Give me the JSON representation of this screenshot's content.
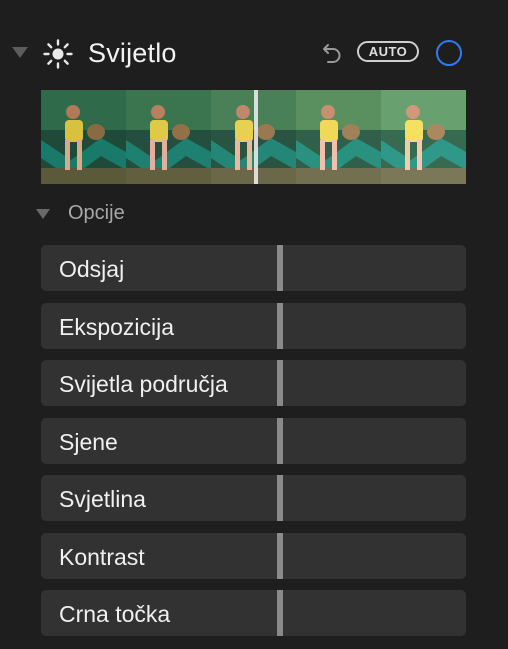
{
  "panel": {
    "title": "Svijetlo",
    "undo_icon": "undo-icon",
    "auto_label": "AUTO",
    "enabled_toggle_color": "#2d7cf6",
    "header_icon": "sun-icon",
    "collapse_icon": "disclosure-triangle-icon"
  },
  "options": {
    "label": "Opcije"
  },
  "sliders": [
    {
      "label": "Odsjaj",
      "value": 0
    },
    {
      "label": "Ekspozicija",
      "value": 0
    },
    {
      "label": "Svijetla područja",
      "value": 0
    },
    {
      "label": "Sjene",
      "value": 0
    },
    {
      "label": "Svjetlina",
      "value": 0
    },
    {
      "label": "Kontrast",
      "value": 0
    },
    {
      "label": "Crna točka",
      "value": 0
    }
  ]
}
